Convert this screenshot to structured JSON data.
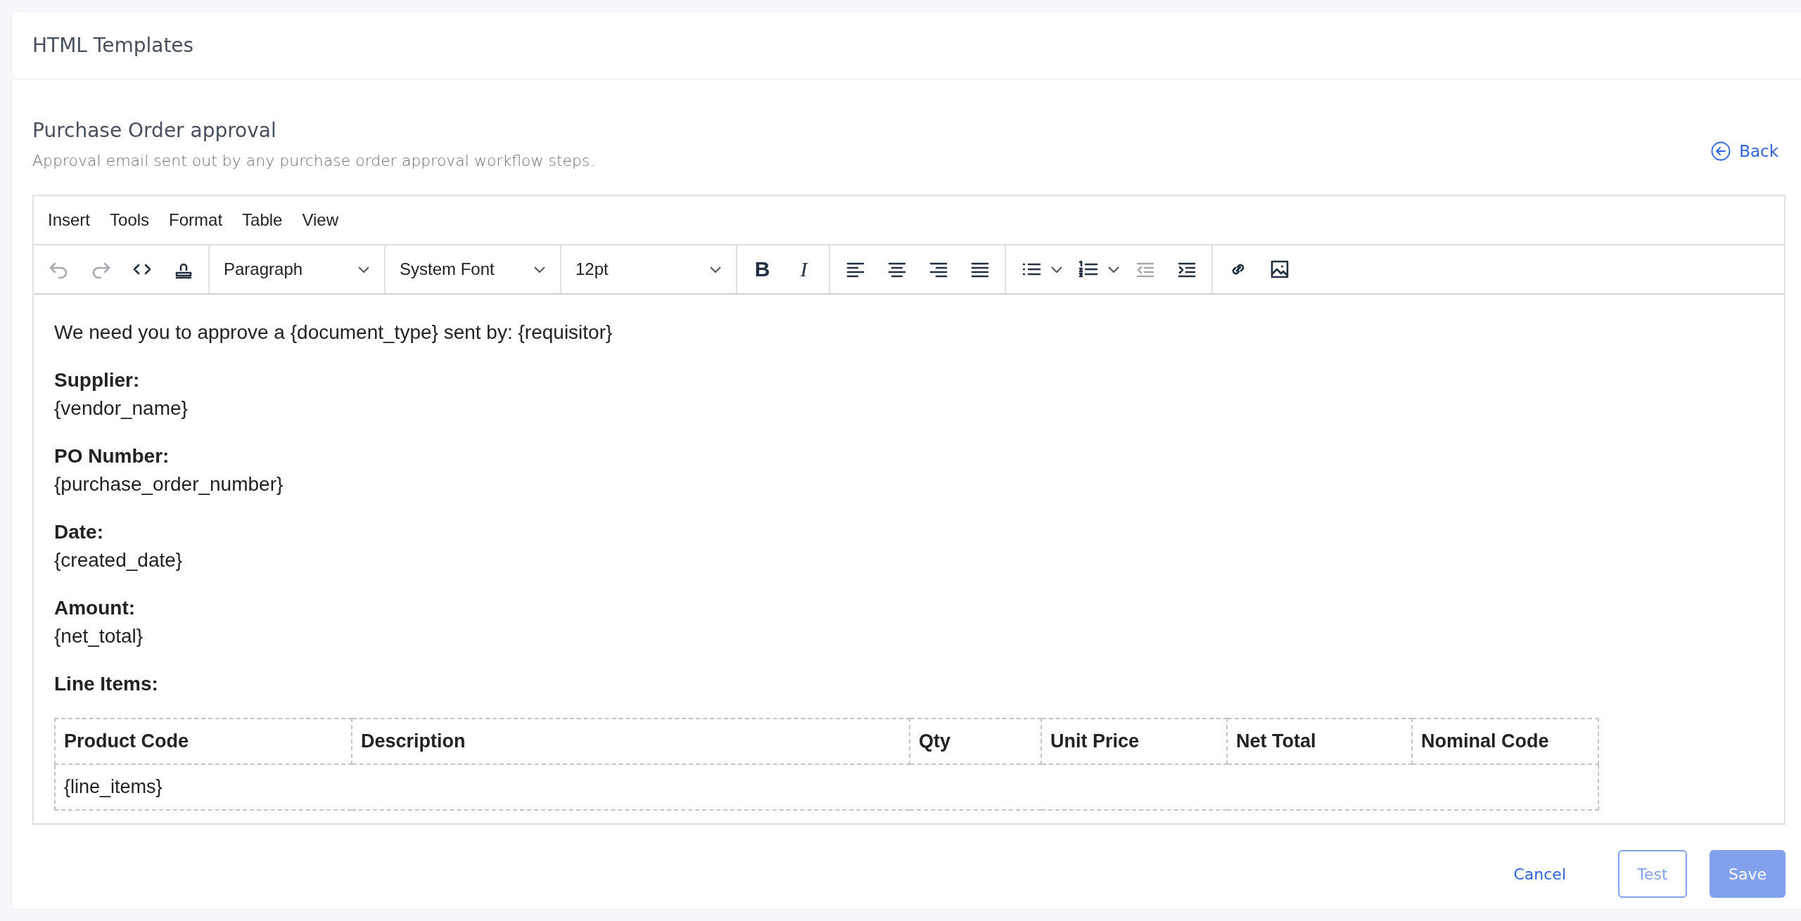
{
  "page": {
    "title": "HTML Templates"
  },
  "template": {
    "title": "Purchase Order approval",
    "description": "Approval email sent out by any purchase order approval workflow steps.",
    "back_link": "Back"
  },
  "editor": {
    "menu": [
      "Insert",
      "Tools",
      "Format",
      "Table",
      "View"
    ],
    "toolbar": [
      [
        {
          "kind": "undo",
          "disabled": true
        },
        {
          "kind": "redo",
          "disabled": true
        },
        {
          "kind": "code",
          "disabled": false
        },
        {
          "kind": "stamp",
          "disabled": false
        }
      ],
      [
        {
          "kind": "dropdown",
          "value": "Paragraph"
        }
      ],
      [
        {
          "kind": "dropdown",
          "value": "System Font"
        }
      ],
      [
        {
          "kind": "dropdown",
          "value": "12pt"
        }
      ],
      [
        {
          "kind": "bold",
          "label": "B",
          "disabled": false
        },
        {
          "kind": "italic",
          "label": "I",
          "disabled": false
        }
      ],
      [
        {
          "kind": "align-left",
          "disabled": false
        },
        {
          "kind": "align-center",
          "disabled": false
        },
        {
          "kind": "align-right",
          "disabled": false
        },
        {
          "kind": "justify",
          "disabled": false
        }
      ],
      [
        {
          "kind": "bullets",
          "disabled": false
        },
        {
          "kind": "numbers",
          "disabled": false
        },
        {
          "kind": "outdent",
          "disabled": true
        },
        {
          "kind": "indent",
          "disabled": false
        }
      ],
      [
        {
          "kind": "link",
          "disabled": false
        },
        {
          "kind": "image",
          "disabled": false
        }
      ]
    ],
    "content": [
      {
        "kind": "line",
        "text": "We need you to approve a {document_type} sent by: {requisitor}"
      },
      {
        "kind": "field",
        "label": "Supplier:",
        "value": "{vendor_name}"
      },
      {
        "kind": "field",
        "label": "PO Number:",
        "value": "{purchase_order_number}"
      },
      {
        "kind": "field",
        "label": "Date:",
        "value": "{created_date}"
      },
      {
        "kind": "field",
        "label": "Amount:",
        "value": "{net_total}"
      },
      {
        "kind": "label",
        "text": "Line Items:"
      }
    ],
    "table": {
      "columns": [
        "Product Code",
        "Description",
        "Qty",
        "Unit Price",
        "Net Total",
        "Nominal Code"
      ],
      "rows": [
        [
          {
            "text": "{line_items}",
            "colspan": 6
          }
        ]
      ]
    }
  },
  "buttons": [
    {
      "kind": "link",
      "label": "Cancel",
      "disabled": false
    },
    {
      "kind": "outline",
      "label": "Test",
      "disabled": true
    },
    {
      "kind": "primary",
      "label": "Save",
      "disabled": true
    }
  ]
}
